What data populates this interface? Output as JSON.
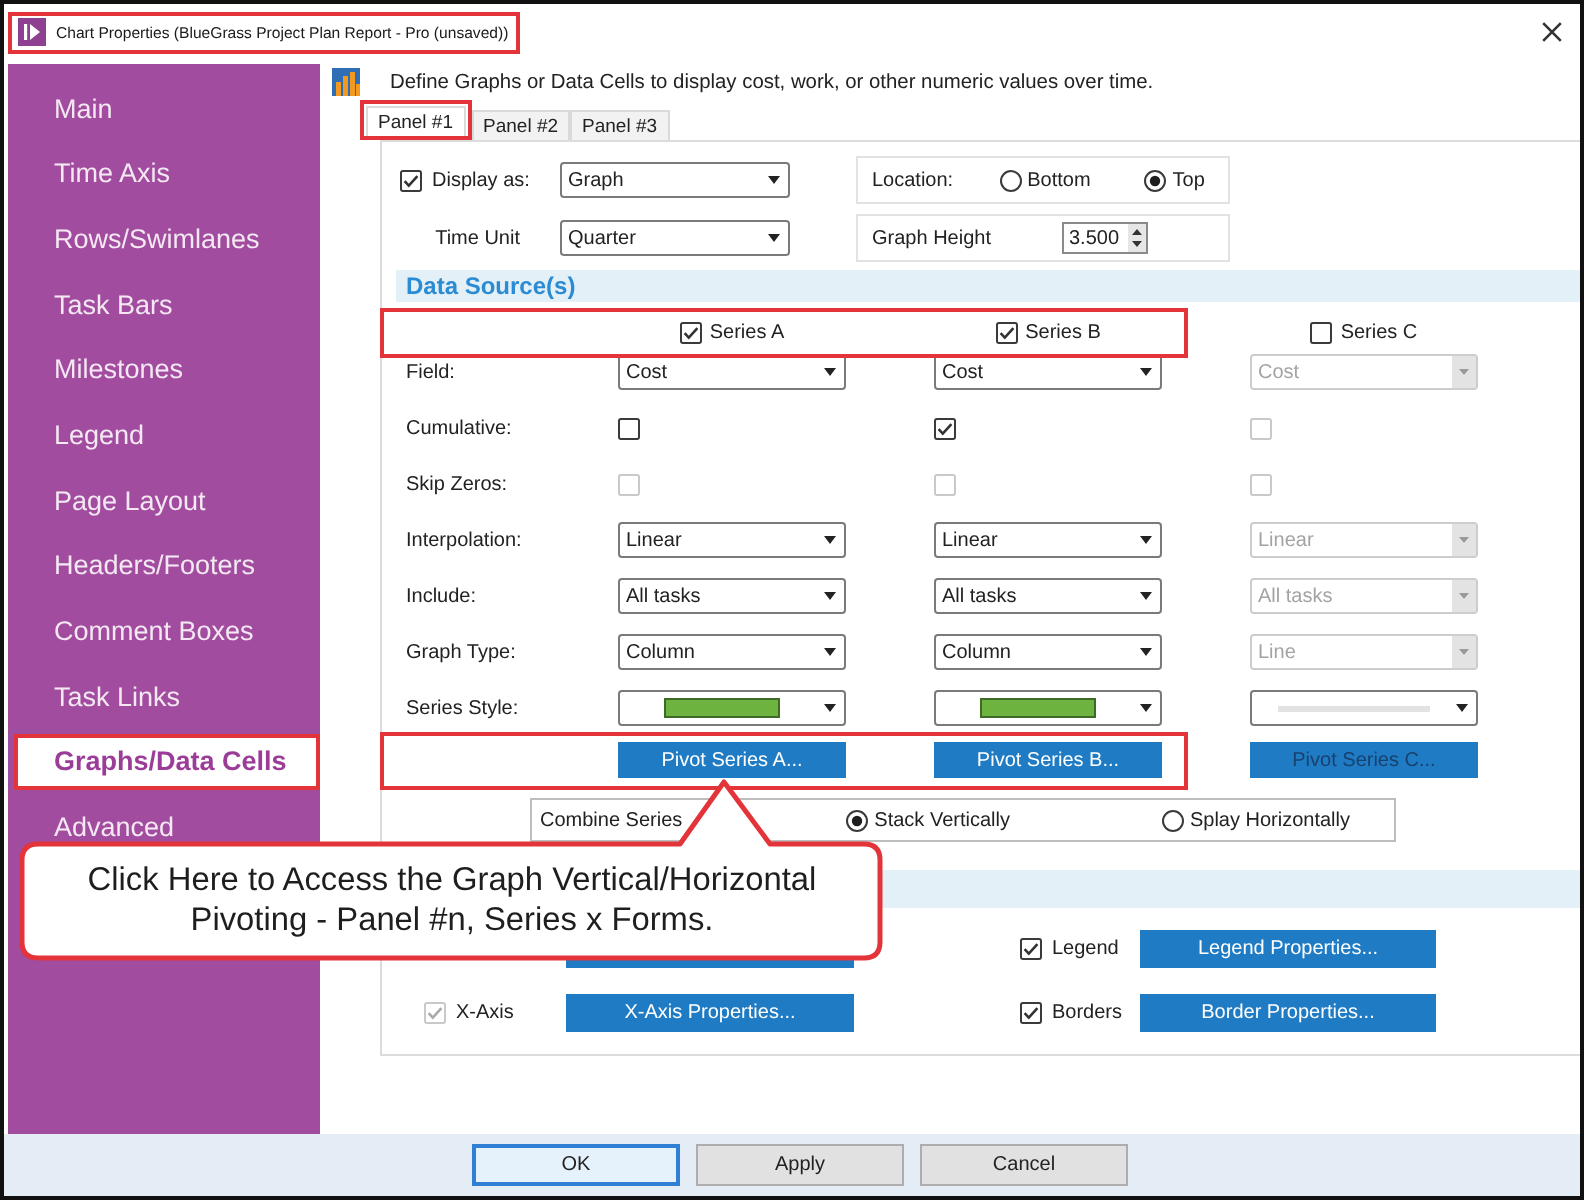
{
  "window": {
    "title": "Chart Properties (BlueGrass Project Plan Report - Pro (unsaved))",
    "title_highlighted": true
  },
  "sidebar": {
    "items": [
      {
        "label": "Main",
        "selected": false,
        "highlighted": false
      },
      {
        "label": "Time Axis",
        "selected": false,
        "highlighted": false
      },
      {
        "label": "Rows/Swimlanes",
        "selected": false,
        "highlighted": false
      },
      {
        "label": "Task Bars",
        "selected": false,
        "highlighted": false
      },
      {
        "label": "Milestones",
        "selected": false,
        "highlighted": false
      },
      {
        "label": "Legend",
        "selected": false,
        "highlighted": false
      },
      {
        "label": "Page Layout",
        "selected": false,
        "highlighted": false
      },
      {
        "label": "Headers/Footers",
        "selected": false,
        "highlighted": false
      },
      {
        "label": "Comment Boxes",
        "selected": false,
        "highlighted": false
      },
      {
        "label": "Task Links",
        "selected": false,
        "highlighted": false
      },
      {
        "label": "Graphs/Data Cells",
        "selected": true,
        "highlighted": true
      },
      {
        "label": "Advanced",
        "selected": false,
        "highlighted": false
      }
    ]
  },
  "description": "Define Graphs or Data Cells to display cost, work, or other numeric values over time.",
  "tabs": [
    {
      "label": "Panel #1",
      "selected": true,
      "highlighted": true
    },
    {
      "label": "Panel #2",
      "selected": false,
      "highlighted": false
    },
    {
      "label": "Panel #3",
      "selected": false,
      "highlighted": false
    }
  ],
  "panel": {
    "display_as": {
      "label": "Display as:",
      "checked": true,
      "value": "Graph"
    },
    "time_unit": {
      "label": "Time Unit",
      "value": "Quarter"
    },
    "location": {
      "label": "Location:",
      "options": [
        {
          "label": "Bottom",
          "selected": false
        },
        {
          "label": "Top",
          "selected": true
        }
      ]
    },
    "graph_height": {
      "label": "Graph Height",
      "value": "3.500"
    },
    "data_source": {
      "title": "Data Source(s)",
      "series_row_highlighted": true,
      "pivot_row_highlighted": true,
      "series": [
        {
          "label": "Series A",
          "checked": true
        },
        {
          "label": "Series B",
          "checked": true
        },
        {
          "label": "Series C",
          "checked": false
        }
      ],
      "rows": [
        {
          "label": "Field:",
          "kind": "dropdown",
          "cells": [
            {
              "value": "Cost",
              "disabled": false
            },
            {
              "value": "Cost",
              "disabled": false
            },
            {
              "value": "Cost",
              "disabled": true
            }
          ]
        },
        {
          "label": "Cumulative:",
          "kind": "checkbox",
          "cells": [
            {
              "checked": false,
              "disabled": false
            },
            {
              "checked": true,
              "disabled": false
            },
            {
              "checked": false,
              "disabled": true
            }
          ]
        },
        {
          "label": "Skip Zeros:",
          "kind": "checkbox",
          "cells": [
            {
              "checked": false,
              "disabled": true
            },
            {
              "checked": false,
              "disabled": true
            },
            {
              "checked": false,
              "disabled": true
            }
          ]
        },
        {
          "label": "Interpolation:",
          "kind": "dropdown",
          "cells": [
            {
              "value": "Linear",
              "disabled": false
            },
            {
              "value": "Linear",
              "disabled": false
            },
            {
              "value": "Linear",
              "disabled": true
            }
          ]
        },
        {
          "label": "Include:",
          "kind": "dropdown",
          "cells": [
            {
              "value": "All tasks",
              "disabled": false
            },
            {
              "value": "All tasks",
              "disabled": false
            },
            {
              "value": "All tasks",
              "disabled": true
            }
          ]
        },
        {
          "label": "Graph Type:",
          "kind": "dropdown",
          "cells": [
            {
              "value": "Column",
              "disabled": false
            },
            {
              "value": "Column",
              "disabled": false
            },
            {
              "value": "Line",
              "disabled": true
            }
          ]
        },
        {
          "label": "Series Style:",
          "kind": "style",
          "cells": [
            {
              "color": "#6db33f",
              "disabled": false
            },
            {
              "color": "#6db33f",
              "disabled": false
            },
            {
              "color": "#e2e2e2",
              "disabled": true
            }
          ]
        }
      ],
      "pivot_buttons": [
        {
          "label": "Pivot Series A...",
          "disabled": false
        },
        {
          "label": "Pivot Series B...",
          "disabled": false
        },
        {
          "label": "Pivot Series C...",
          "disabled": true
        }
      ]
    },
    "combine_series": {
      "label": "Combine Series",
      "options": [
        {
          "label": "Stack Vertically",
          "selected": true
        },
        {
          "label": "Splay Horizontally",
          "selected": false
        }
      ]
    },
    "properties": [
      {
        "kind": "covered"
      },
      {
        "kind": "option",
        "label": "Legend",
        "checked": true,
        "disabled": false,
        "button": "Legend Properties..."
      },
      {
        "kind": "option",
        "label": "X-Axis",
        "checked": true,
        "disabled": true,
        "button": "X-Axis Properties..."
      },
      {
        "kind": "option",
        "label": "Borders",
        "checked": true,
        "disabled": false,
        "button": "Border Properties..."
      }
    ]
  },
  "callout": {
    "text": "Click Here to Access the Graph Vertical/Horizontal Pivoting - Panel #n, Series x Forms."
  },
  "buttons": [
    {
      "label": "OK",
      "default": true
    },
    {
      "label": "Apply",
      "default": false
    },
    {
      "label": "Cancel",
      "default": false
    }
  ]
}
